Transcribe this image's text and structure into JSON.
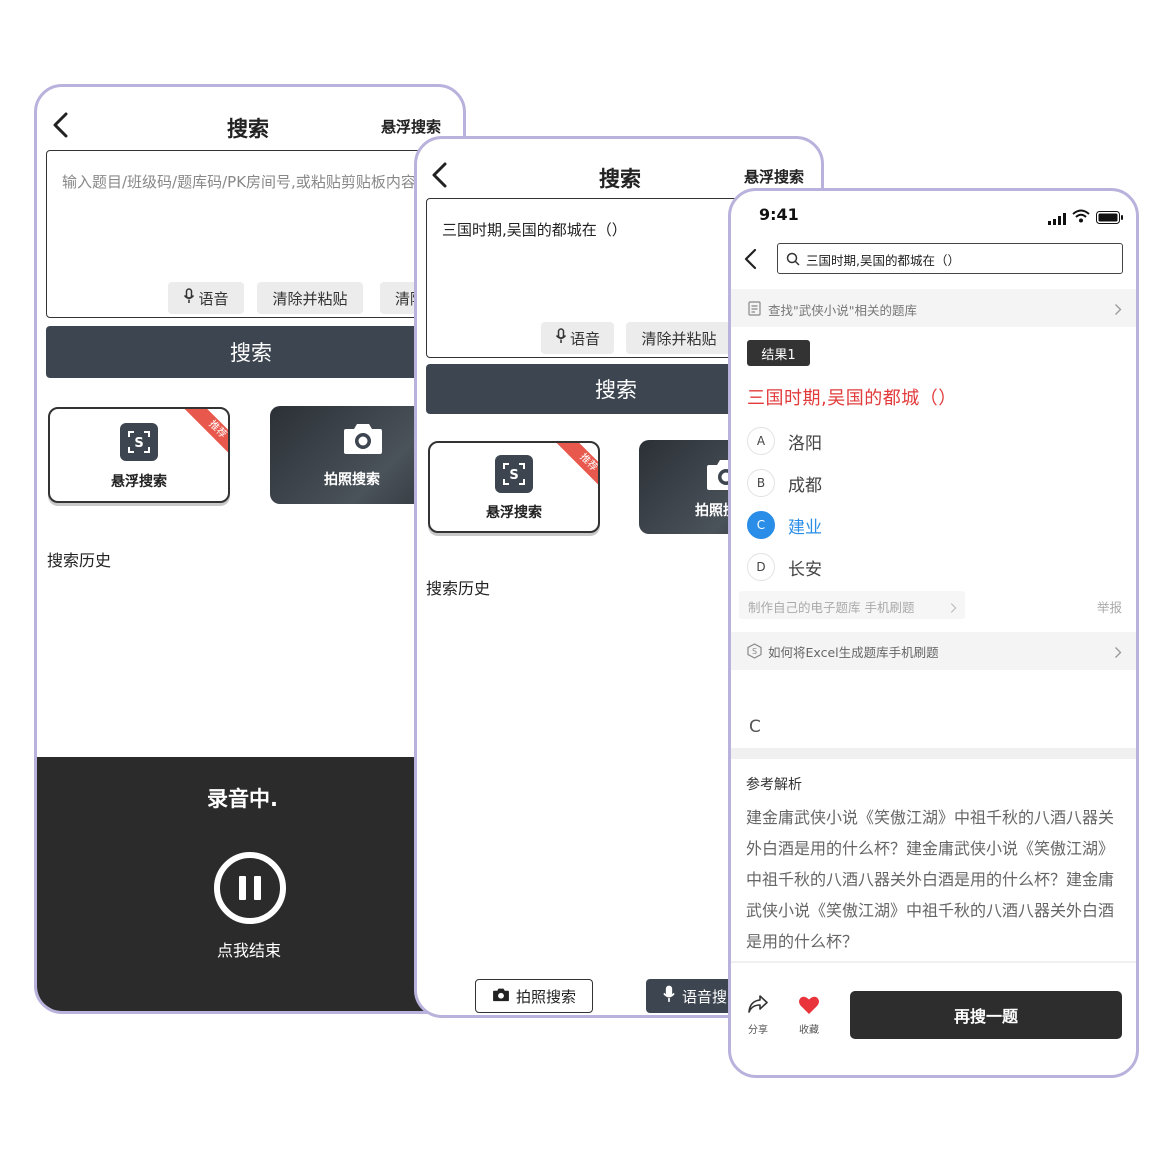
{
  "screen1": {
    "title": "搜索",
    "right_action": "悬浮搜索",
    "input_placeholder": "输入题目/班级码/题库码/PK房间号,或粘贴剪贴板内容",
    "chips": [
      "语音",
      "清除并粘贴",
      "清除"
    ],
    "search_button": "搜索",
    "card_float": "悬浮搜索",
    "card_photo": "拍照搜索",
    "ribbon": "推荐",
    "history_title": "搜索历史",
    "recording_title": "录音中.",
    "recording_action": "点我结束"
  },
  "screen2": {
    "title": "搜索",
    "right_action": "悬浮搜索",
    "input_value": "三国时期,吴国的都城在（）",
    "chips": [
      "语音",
      "清除并粘贴"
    ],
    "search_button": "搜索",
    "card_float": "悬浮搜索",
    "card_photo": "拍照搜索",
    "ribbon": "推荐",
    "history_title": "搜索历史",
    "bottom_photo": "拍照搜索",
    "bottom_voice": "语音搜索"
  },
  "screen3": {
    "status_time": "9:41",
    "search_query": "三国时期,吴国的都城在（）",
    "related_bank": "查找\"武侠小说\"相关的题库",
    "result_tag": "结果1",
    "question": "三国时期,吴国的都城（）",
    "options": [
      {
        "letter": "A",
        "text": "洛阳",
        "selected": false
      },
      {
        "letter": "B",
        "text": "成都",
        "selected": false
      },
      {
        "letter": "C",
        "text": "建业",
        "selected": true
      },
      {
        "letter": "D",
        "text": "长安",
        "selected": false
      }
    ],
    "promo_link": "制作自己的电子题库 手机刷题",
    "report": "举报",
    "excel_link": "如何将Excel生成题库手机刷题",
    "answer": "C",
    "explain_title": "参考解析",
    "explain_text": "建金庸武侠小说《笑傲江湖》中祖千秋的八酒八器关外白酒是用的什么杯？建金庸武侠小说《笑傲江湖》中祖千秋的八酒八器关外白酒是用的什么杯？建金庸武侠小说《笑傲江湖》中祖千秋的八酒八器关外白酒是用的什么杯？",
    "share_label": "分享",
    "favorite_label": "收藏",
    "again_button": "再搜一题"
  },
  "colors": {
    "frame": "#b9b2dc",
    "dark_button": "#3d4650",
    "question_red": "#e23b3b",
    "answer_blue": "#2a8de8",
    "ribbon_red": "#e8584c",
    "heart_red": "#e8343a"
  },
  "icons": [
    "back-arrow-icon",
    "mic-icon",
    "camera-icon",
    "float-search-icon",
    "search-icon",
    "doc-icon",
    "share-icon",
    "heart-icon",
    "chevron-right-icon",
    "signal-icon",
    "wifi-icon",
    "battery-icon",
    "pause-icon"
  ]
}
